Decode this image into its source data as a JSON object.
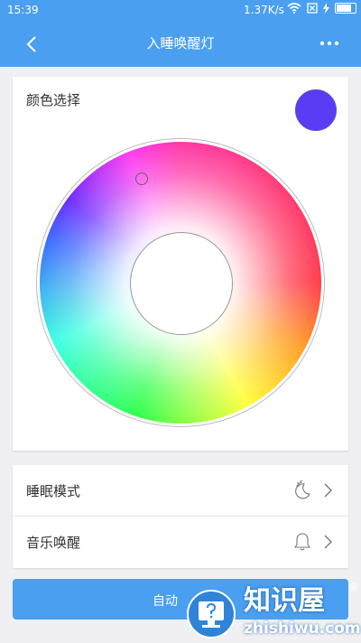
{
  "status_bar": {
    "time": "15:39",
    "net_speed": "1.37K/s",
    "icons": [
      "wifi-icon",
      "sim-absent-icon",
      "charging-icon",
      "battery-icon"
    ]
  },
  "header": {
    "title": "入睡唤醒灯",
    "back_icon": "chevron-left-icon",
    "more_icon": "more-dots-icon",
    "bg_color": "#4a9ff0"
  },
  "color_card": {
    "label": "颜色选择",
    "selected_color": "#5b3cf5"
  },
  "settings": {
    "rows": [
      {
        "label": "睡眠模式",
        "icon": "moon-sleep-icon"
      },
      {
        "label": "音乐唤醒",
        "icon": "bell-icon"
      }
    ]
  },
  "auto_button": {
    "label": "自动"
  },
  "watermark": {
    "title": "知识屋",
    "reg": "®",
    "subtitle": "zhishiwu.com"
  }
}
